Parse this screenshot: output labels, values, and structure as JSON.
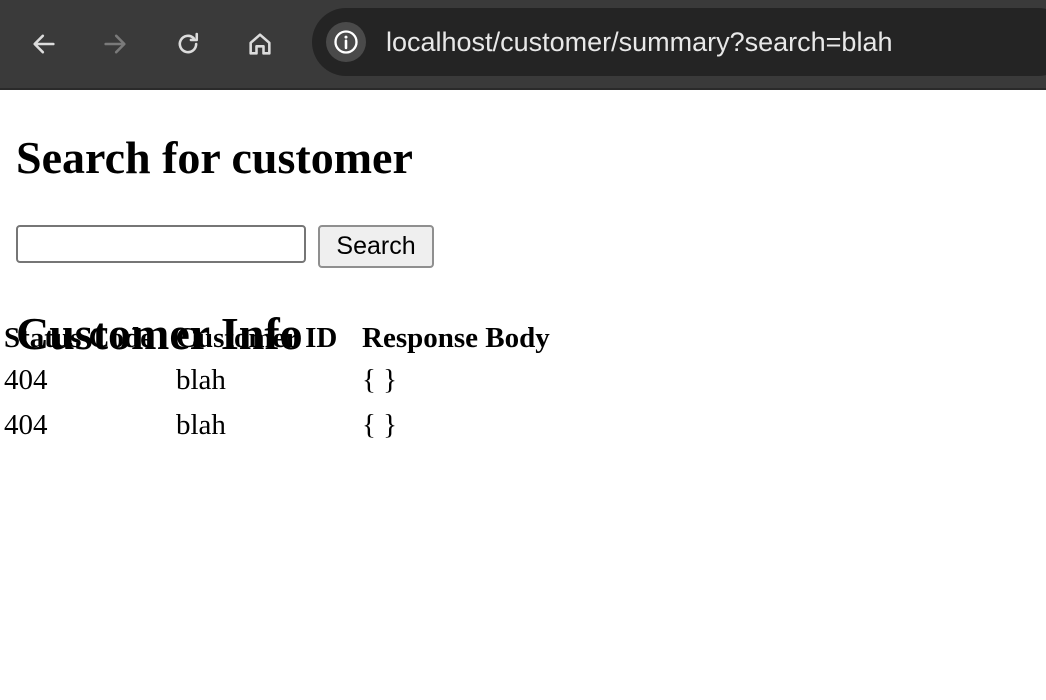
{
  "browser": {
    "url": "localhost/customer/summary?search=blah",
    "icons": [
      "back-icon",
      "forward-icon",
      "reload-icon",
      "home-icon",
      "site-info-icon"
    ]
  },
  "page": {
    "search_heading": "Search for customer",
    "search_input_value": "",
    "search_button_label": "Search",
    "info_heading": "Customer Info",
    "table": {
      "headers": [
        "Status Code",
        "Customer ID",
        "Response Body"
      ],
      "rows": [
        [
          "404",
          "blah",
          "{ }"
        ],
        [
          "404",
          "blah",
          "{ }"
        ]
      ]
    }
  },
  "colors": {
    "toolbar_bg": "#3a3a3a",
    "omnibox_bg": "#242424",
    "url_text": "#e8e8e8"
  }
}
